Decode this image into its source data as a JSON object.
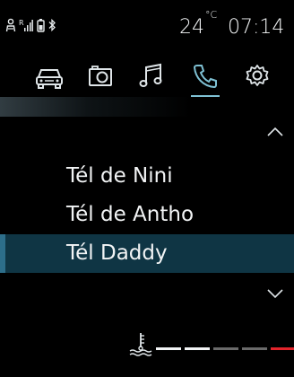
{
  "status_bar": {
    "temperature_value": "24",
    "temperature_unit": "°C",
    "time": "07:14",
    "icons": [
      "user-profile-icon",
      "signal-strength-icon",
      "battery-icon",
      "bluetooth-icon"
    ],
    "signal_glyph": "R"
  },
  "tabs": [
    {
      "name": "vehicle",
      "icon": "car-icon",
      "active": false
    },
    {
      "name": "camera",
      "icon": "camera-icon",
      "active": false
    },
    {
      "name": "media",
      "icon": "music-note-icon",
      "active": false
    },
    {
      "name": "phone",
      "icon": "phone-icon",
      "active": true
    },
    {
      "name": "settings",
      "icon": "gear-icon",
      "active": false
    }
  ],
  "contacts": [
    {
      "label": "Tél de Nini",
      "selected": false
    },
    {
      "label": "Tél de Antho",
      "selected": false
    },
    {
      "label": "Tél Daddy",
      "selected": true
    }
  ],
  "bottom_bar": {
    "coolant_icon": "coolant-temperature-icon",
    "level_segments": [
      {
        "state": "on",
        "color": "#f2f4f5"
      },
      {
        "state": "on",
        "color": "#f2f4f5"
      },
      {
        "state": "off",
        "color": "#6a6a6a"
      },
      {
        "state": "off",
        "color": "#6a6a6a"
      },
      {
        "state": "warning",
        "color": "#e3242b"
      }
    ]
  },
  "colors": {
    "accent": "#7fc1d4",
    "selection_bg": "#0f3544",
    "selection_edge": "#2d6e8a",
    "warning": "#e3242b"
  }
}
